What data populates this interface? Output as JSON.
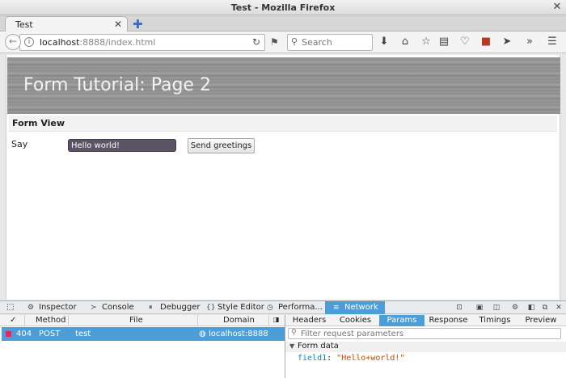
{
  "window": {
    "title": "Test - Mozilla Firefox",
    "close_glyph": "✕"
  },
  "tab": {
    "label": "Test",
    "close_glyph": "✕",
    "new_tab_glyph": "✚"
  },
  "nav": {
    "url_host": "localhost",
    "url_rest": ":8888/index.html",
    "search_placeholder": "Search"
  },
  "page": {
    "banner_title": "Form Tutorial: Page 2",
    "section_title": "Form View",
    "say_label": "Say",
    "say_value": "Hello world!",
    "button_label": "Send greetings"
  },
  "devtools": {
    "tabs": [
      "Inspector",
      "Console",
      "Debugger",
      "Style Editor",
      "Performa...",
      "Network"
    ],
    "active_tab": "Network",
    "request_columns": [
      "✓",
      "Method",
      "File",
      "Domain"
    ],
    "request": {
      "status": "404",
      "method": "POST",
      "file": "test",
      "domain": "localhost:8888"
    },
    "detail_tabs": [
      "Headers",
      "Cookies",
      "Params",
      "Response",
      "Timings",
      "Preview"
    ],
    "active_detail_tab": "Params",
    "filter_placeholder": "Filter request parameters",
    "form_data_label": "Form data",
    "param_key": "field1",
    "param_value": "\"Hello+world!\""
  },
  "colors": {
    "accent": "#4c9ed9",
    "status_error": "#ed2655"
  }
}
